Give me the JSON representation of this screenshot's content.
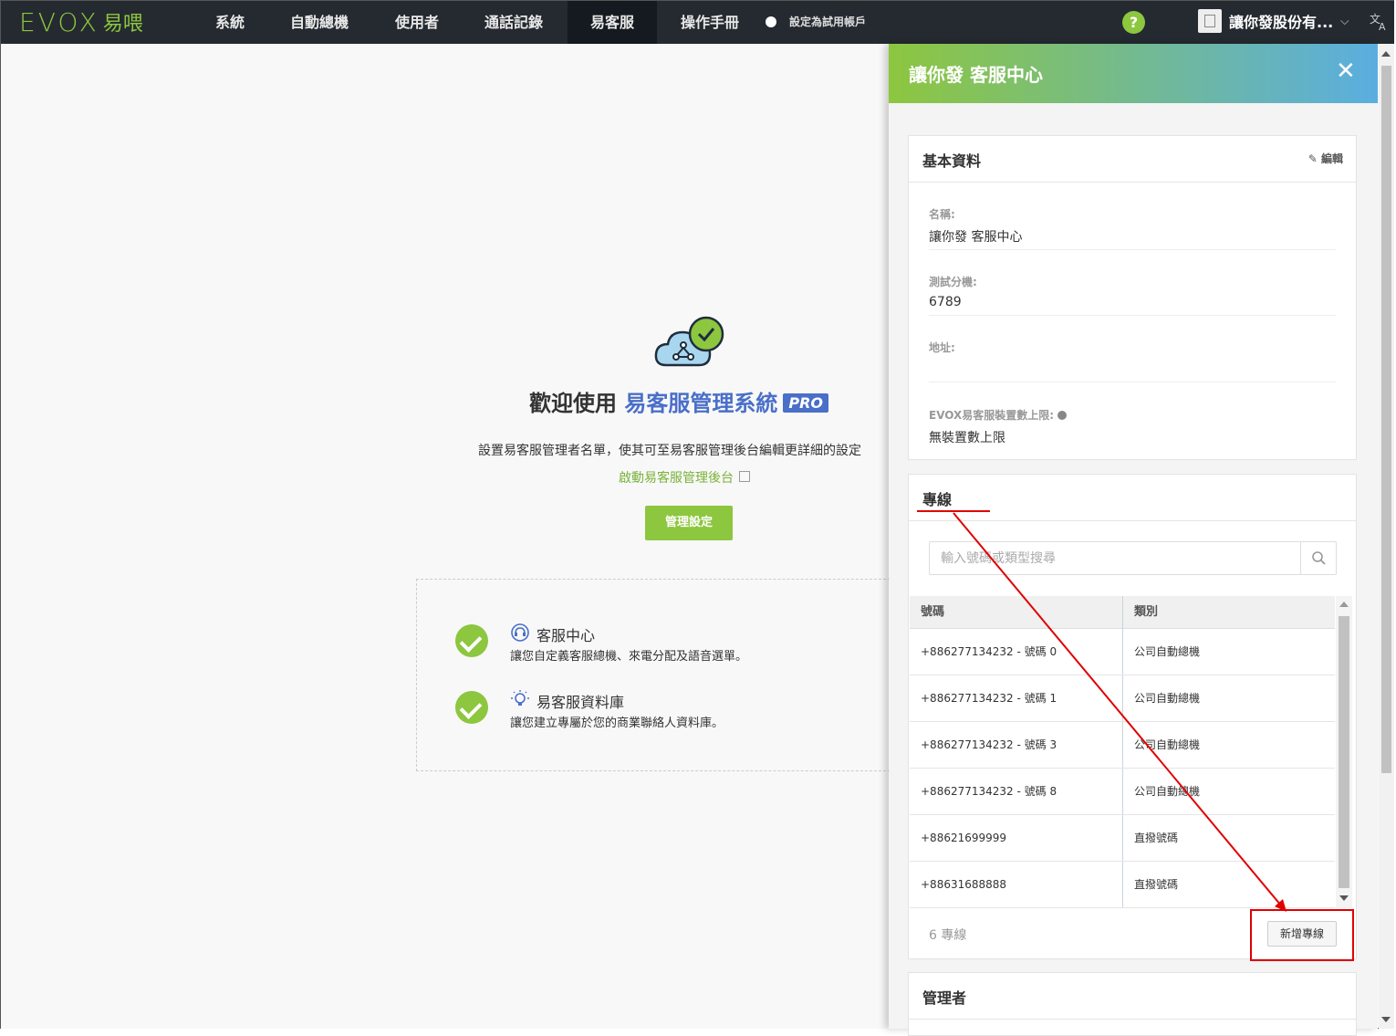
{
  "brand": {
    "logo_text": "EVOX",
    "logo_zh": "易喂"
  },
  "nav": {
    "items": [
      "系統",
      "自動總機",
      "使用者",
      "通話記錄",
      "易客服",
      "操作手冊"
    ],
    "active": "易客服",
    "trial_label": "設定為試用帳戶",
    "help": "?",
    "company": "讓你發股份有...",
    "lang_icon": "translate-icon"
  },
  "welcome": {
    "prefix": "歡迎使用",
    "product": "易客服管理系統",
    "badge": "PRO",
    "description": "設置易客服管理者名單，使其可至易客服管理後台編輯更詳細的設定",
    "launch_link": "啟動易客服管理後台",
    "manage_button": "管理設定"
  },
  "features": [
    {
      "title": "客服中心",
      "desc": "讓您自定義客服總機、來電分配及語音選單。",
      "icon": "headset-icon"
    },
    {
      "title": "易客服資料庫",
      "desc": "讓您建立專屬於您的商業聯絡人資料庫。",
      "icon": "lightbulb-icon"
    }
  ],
  "panel": {
    "title": "讓你發 客服中心",
    "basic": {
      "title": "基本資料",
      "edit": "編輯",
      "fields": [
        {
          "label": "名稱:",
          "value": "讓你發 客服中心"
        },
        {
          "label": "測試分機:",
          "value": "6789"
        },
        {
          "label": "地址:",
          "value": ""
        },
        {
          "label": "EVOX易客服裝置數上限:",
          "value": "無裝置數上限"
        }
      ]
    },
    "lines": {
      "title": "專線",
      "search_placeholder": "輸入號碼或類型搜尋",
      "columns": [
        "號碼",
        "類別"
      ],
      "rows": [
        {
          "number": "+886277134232 - 號碼 0",
          "type": "公司自動總機"
        },
        {
          "number": "+886277134232 - 號碼 1",
          "type": "公司自動總機"
        },
        {
          "number": "+886277134232 - 號碼 3",
          "type": "公司自動總機"
        },
        {
          "number": "+886277134232 - 號碼 8",
          "type": "公司自動總機"
        },
        {
          "number": "+88621699999",
          "type": "直撥號碼"
        },
        {
          "number": "+88631688888",
          "type": "直撥號碼"
        }
      ],
      "count": "6 專線",
      "add_button": "新增專線"
    },
    "admins": {
      "title": "管理者"
    }
  },
  "colors": {
    "accent": "#8dc63f",
    "brand_blue": "#4a6fc9",
    "annotation": "#e00000",
    "nav_bg": "#242a30"
  }
}
